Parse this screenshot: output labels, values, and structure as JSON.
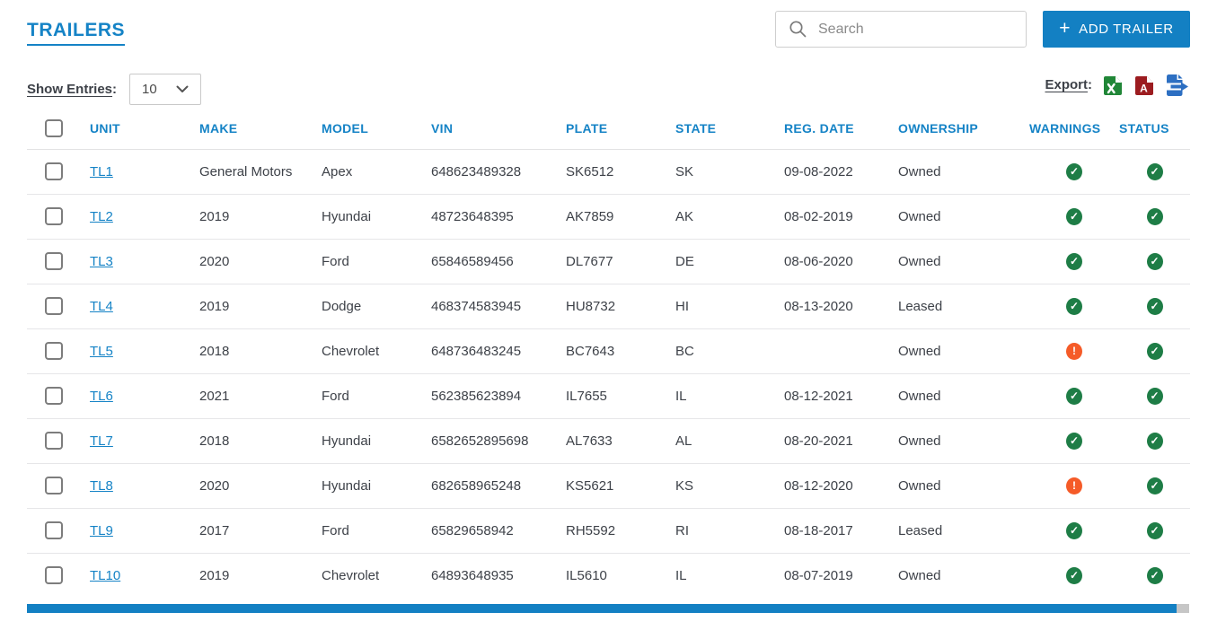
{
  "page": {
    "title": "TRAILERS"
  },
  "search": {
    "placeholder": "Search"
  },
  "add_button": {
    "plus": "+",
    "label": "ADD TRAILER"
  },
  "controls": {
    "show_entries_label": "Show Entries",
    "colon": ":",
    "page_size": "10",
    "export_label": "Export"
  },
  "icons": {
    "check": "✓",
    "alert": "!",
    "search_icon": "magnifier",
    "chevron_down_icon": "chevron-down",
    "excel_icon": "excel-file",
    "pdf_icon": "pdf-file",
    "share_icon": "export-file"
  },
  "colors": {
    "accent_blue": "#1380c3",
    "header_blue": "#1583c6",
    "success_green": "#1e7d46",
    "warning_orange": "#f55b28",
    "excel_green": "#208637",
    "pdf_red": "#9c1c20",
    "share_blue": "#2d6fc2"
  },
  "table": {
    "columns": [
      "UNIT",
      "MAKE",
      "MODEL",
      "VIN",
      "PLATE",
      "STATE",
      "REG. DATE",
      "OWNERSHIP",
      "WARNINGS",
      "STATUS"
    ],
    "rows": [
      {
        "unit": "TL1",
        "make": "General Motors",
        "model": "Apex",
        "vin": "648623489328",
        "plate": "SK6512",
        "state": "SK",
        "reg_date": "09-08-2022",
        "ownership": "Owned",
        "warnings": "ok",
        "status": "ok"
      },
      {
        "unit": "TL2",
        "make": "2019",
        "model": "Hyundai",
        "vin": "48723648395",
        "plate": "AK7859",
        "state": "AK",
        "reg_date": "08-02-2019",
        "ownership": "Owned",
        "warnings": "ok",
        "status": "ok"
      },
      {
        "unit": "TL3",
        "make": "2020",
        "model": "Ford",
        "vin": "65846589456",
        "plate": "DL7677",
        "state": "DE",
        "reg_date": "08-06-2020",
        "ownership": "Owned",
        "warnings": "ok",
        "status": "ok"
      },
      {
        "unit": "TL4",
        "make": "2019",
        "model": "Dodge",
        "vin": "468374583945",
        "plate": "HU8732",
        "state": "HI",
        "reg_date": "08-13-2020",
        "ownership": "Leased",
        "warnings": "ok",
        "status": "ok"
      },
      {
        "unit": "TL5",
        "make": "2018",
        "model": "Chevrolet",
        "vin": "648736483245",
        "plate": "BC7643",
        "state": "BC",
        "reg_date": "",
        "ownership": "Owned",
        "warnings": "alert",
        "status": "ok"
      },
      {
        "unit": "TL6",
        "make": "2021",
        "model": "Ford",
        "vin": "562385623894",
        "plate": "IL7655",
        "state": "IL",
        "reg_date": "08-12-2021",
        "ownership": "Owned",
        "warnings": "ok",
        "status": "ok"
      },
      {
        "unit": "TL7",
        "make": "2018",
        "model": "Hyundai",
        "vin": "6582652895698",
        "plate": "AL7633",
        "state": "AL",
        "reg_date": "08-20-2021",
        "ownership": "Owned",
        "warnings": "ok",
        "status": "ok"
      },
      {
        "unit": "TL8",
        "make": "2020",
        "model": "Hyundai",
        "vin": "682658965248",
        "plate": "KS5621",
        "state": "KS",
        "reg_date": "08-12-2020",
        "ownership": "Owned",
        "warnings": "alert",
        "status": "ok"
      },
      {
        "unit": "TL9",
        "make": "2017",
        "model": "Ford",
        "vin": "65829658942",
        "plate": "RH5592",
        "state": "RI",
        "reg_date": "08-18-2017",
        "ownership": "Leased",
        "warnings": "ok",
        "status": "ok"
      },
      {
        "unit": "TL10",
        "make": "2019",
        "model": "Chevrolet",
        "vin": "64893648935",
        "plate": "IL5610",
        "state": "IL",
        "reg_date": "08-07-2019",
        "ownership": "Owned",
        "warnings": "ok",
        "status": "ok"
      }
    ]
  }
}
